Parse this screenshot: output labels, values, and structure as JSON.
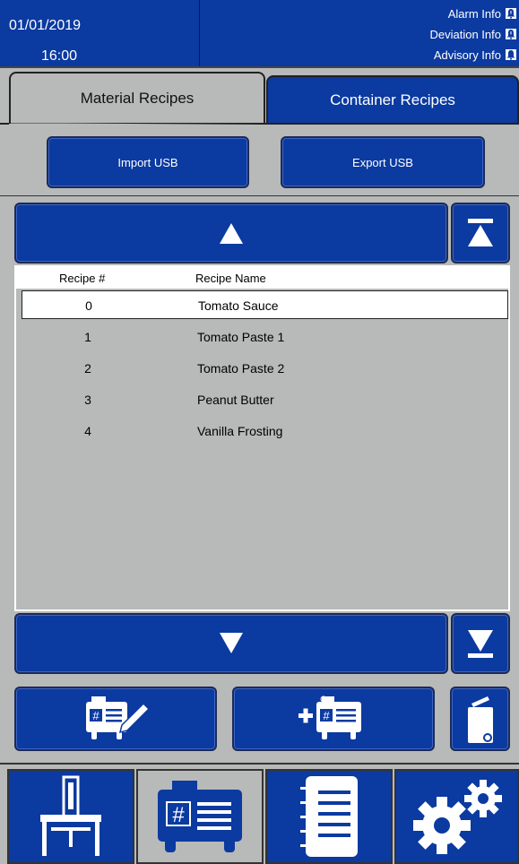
{
  "header": {
    "date": "01/01/2019",
    "time": "16:00",
    "alarm_label": "Alarm Info",
    "deviation_label": "Deviation Info",
    "advisory_label": "Advisory Info"
  },
  "tabs": {
    "material": "Material Recipes",
    "container": "Container Recipes",
    "active": "Material Recipes"
  },
  "buttons": {
    "import": "Import USB",
    "export": "Export USB"
  },
  "table": {
    "columns": [
      "Recipe #",
      "Recipe Name"
    ],
    "selected_index": 0,
    "rows": [
      {
        "num": "0",
        "name": "Tomato Sauce"
      },
      {
        "num": "1",
        "name": "Tomato Paste 1"
      },
      {
        "num": "2",
        "name": "Tomato Paste 2"
      },
      {
        "num": "3",
        "name": "Peanut Butter"
      },
      {
        "num": "4",
        "name": "Vanilla Frosting"
      }
    ]
  },
  "colors": {
    "accent": "#0b3aa0",
    "background": "#b7bab8"
  },
  "icons": {
    "scroll_up": "triangle-up-icon",
    "scroll_top": "skip-to-top-icon",
    "scroll_down": "triangle-down-icon",
    "scroll_bottom": "skip-to-bottom-icon",
    "edit": "edit-recipe-icon",
    "add": "add-recipe-icon",
    "delete": "trash-icon",
    "nav": [
      "machine-icon",
      "recipe-card-icon",
      "notebook-icon",
      "gears-icon"
    ]
  }
}
